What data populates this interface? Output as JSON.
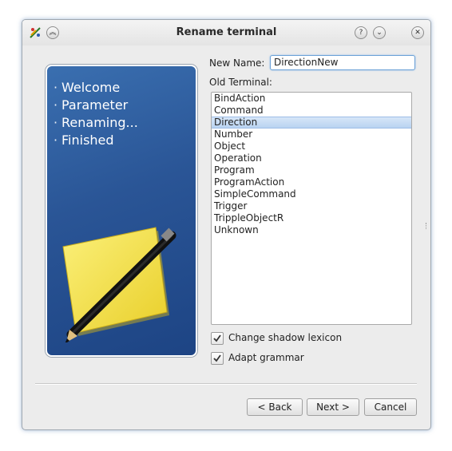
{
  "window": {
    "title": "Rename terminal",
    "titlebar_buttons": {
      "help": "?",
      "minimize": "⌄",
      "close": "✕",
      "keep_above": "︽"
    }
  },
  "sidebar": {
    "steps": [
      "Welcome",
      "Parameter",
      "Renaming...",
      "Finished"
    ],
    "bullet": "·"
  },
  "form": {
    "new_name_label": "New Name:",
    "new_name_value": "DirectionNew",
    "old_terminal_label": "Old Terminal:",
    "terminals": [
      "BindAction",
      "Command",
      "Direction",
      "Number",
      "Object",
      "Operation",
      "Program",
      "ProgramAction",
      "SimpleCommand",
      "Trigger",
      "TrippleObjectR",
      "Unknown"
    ],
    "selected_terminal": "Direction",
    "change_shadow_lexicon_label": "Change shadow lexicon",
    "change_shadow_lexicon_checked": true,
    "adapt_grammar_label": "Adapt grammar",
    "adapt_grammar_checked": true
  },
  "buttons": {
    "back": "< Back",
    "next": "Next >",
    "cancel": "Cancel"
  },
  "colors": {
    "sidebar_top": "#3a6fb0",
    "sidebar_bottom": "#1d4484",
    "selection": "#b9d3f1",
    "note_yellow": "#f7e24a"
  }
}
